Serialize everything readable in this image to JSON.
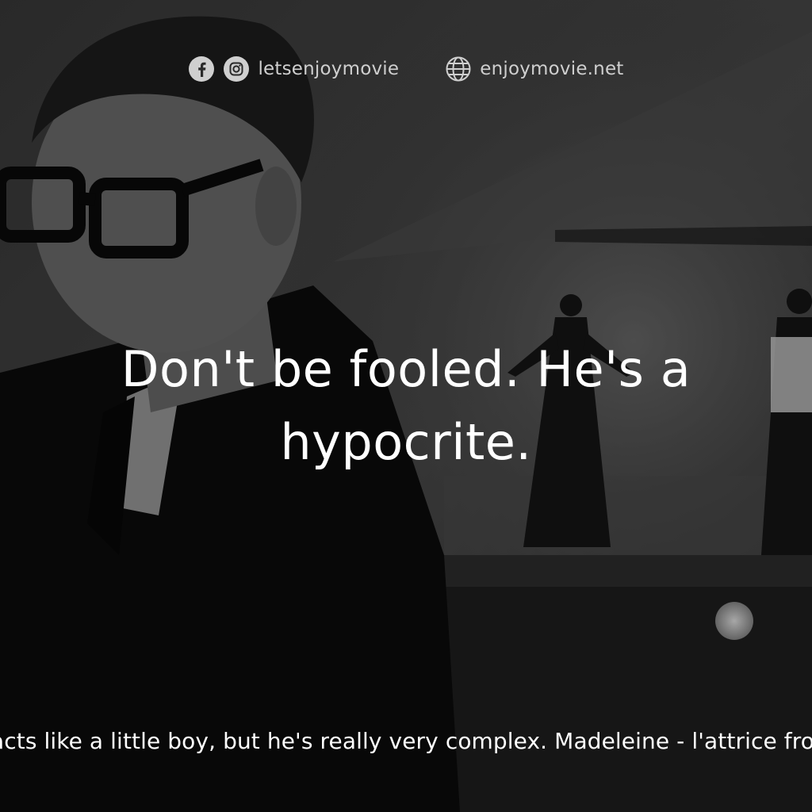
{
  "social": {
    "handle": "letsenjoymovie",
    "website": "enjoymovie.net",
    "handle_icons": [
      "facebook-icon",
      "instagram-icon"
    ],
    "website_icon": "globe-icon"
  },
  "quote": {
    "text": "Don't be fooled. He's a hypocrite."
  },
  "footer": {
    "text": "acts like a little boy, but he's really very complex. Madeleine - l'attrice fro"
  },
  "colors": {
    "text": "#ffffff",
    "social_text": "#cfcfcf",
    "overlay": "#000000"
  }
}
